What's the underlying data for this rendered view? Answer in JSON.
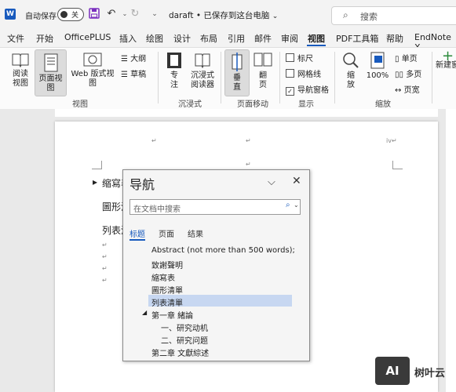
{
  "titlebar": {
    "logo": "W",
    "autosave_label": "自动保存",
    "toggle_label": "关",
    "doc_title": "daraft • 已保存到这台电脑",
    "search_placeholder": "搜索"
  },
  "menu": [
    "文件",
    "开始",
    "OfficePLUS",
    "插入",
    "绘图",
    "设计",
    "布局",
    "引用",
    "邮件",
    "审阅",
    "视图",
    "PDF工具箱",
    "帮助",
    "EndNote X"
  ],
  "menu_active": "视图",
  "ribbon": {
    "read_view": "阅读\n视图",
    "page_view": "页面视图",
    "web_view": "Web 版式视图",
    "outline": "大纲",
    "draft": "草稿",
    "group_view": "视图",
    "focus": "专\n注",
    "immersive_reader": "沉浸式\n阅读器",
    "group_immersive": "沉浸式",
    "vertical": "垂\n直",
    "side_to_side": "翻\n页",
    "group_page_move": "页面移动",
    "ruler": "标尺",
    "gridlines": "网格线",
    "nav_pane": "导航窗格",
    "group_show": "显示",
    "zoom": "缩\n放",
    "zoom_100": "100%",
    "one_page": "单页",
    "multi_page": "多页",
    "page_width": "页宽",
    "group_zoom": "缩放",
    "new_window": "新建窗"
  },
  "document": {
    "heading1": "缩寫表",
    "line2": "圖形清",
    "line3": "列表清",
    "header_right": "iv"
  },
  "nav": {
    "title": "导航",
    "search_placeholder": "在文档中搜索",
    "tabs": [
      "标题",
      "页面",
      "结果"
    ],
    "items": [
      "Abstract  (not more than 500 words);",
      "致謝聲明",
      "縮寫表",
      "圖形清單",
      "列表清單",
      "第一章  緒論",
      "一、研究动机",
      "二、研究问题",
      "第二章  文獻綜述"
    ]
  },
  "watermark": {
    "logo": "AI",
    "text": "树叶云"
  }
}
